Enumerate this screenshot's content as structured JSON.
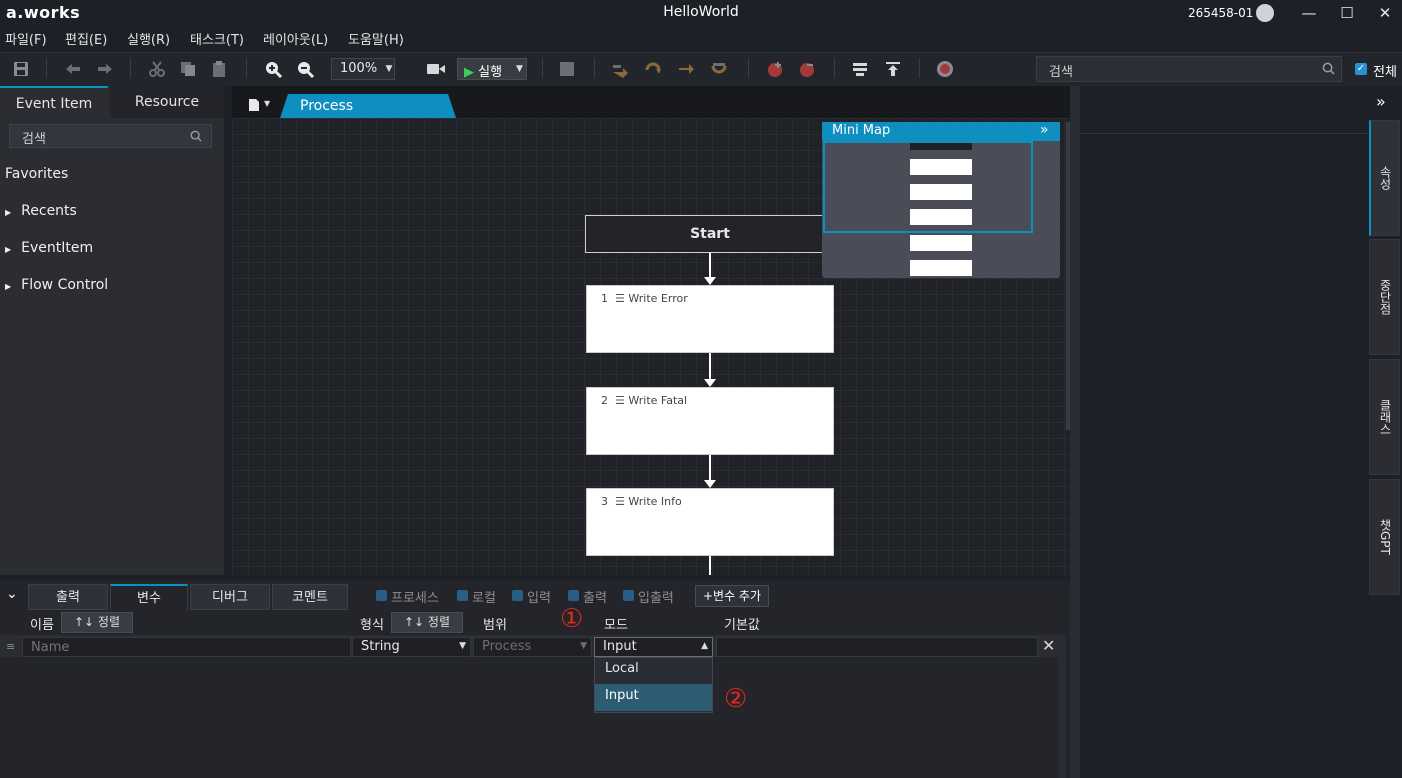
{
  "app": {
    "logo": "a.works",
    "title": "HelloWorld",
    "user_id": "265458-01"
  },
  "menu": [
    "파일(F)",
    "편집(E)",
    "실행(R)",
    "태스크(T)",
    "레이아웃(L)",
    "도움말(H)"
  ],
  "toolbar": {
    "zoom": "100%",
    "run_label": "실행",
    "search_placeholder": "검색",
    "all_label": "전체"
  },
  "left_panel": {
    "tabs": [
      "Event Item",
      "Resource"
    ],
    "search_placeholder": "검색",
    "favorites": "Favorites",
    "tree": [
      "Recents",
      "EventItem",
      "Flow Control"
    ]
  },
  "canvas": {
    "tab": "Process",
    "start": "Start",
    "nodes": [
      {
        "num": "1",
        "label": "Write Error"
      },
      {
        "num": "2",
        "label": "Write Fatal"
      },
      {
        "num": "3",
        "label": "Write Info"
      }
    ],
    "minimap_title": "Mini Map"
  },
  "right_tabs": [
    "속성",
    "중단점",
    "클래스",
    "챗GPT"
  ],
  "bottom": {
    "tabs": [
      "출력",
      "변수",
      "디버그",
      "코멘트"
    ],
    "filters": [
      "프로세스",
      "로컬",
      "입력",
      "출력",
      "입출력"
    ],
    "add_var": "+변수 추가",
    "columns": {
      "name": "이름",
      "type": "형식",
      "scope": "범위",
      "mode": "모드",
      "default": "기본값"
    },
    "sort": "↑↓ 정렬",
    "row": {
      "name_placeholder": "Name",
      "type": "String",
      "scope": "Process",
      "mode": "Input"
    },
    "mode_options": [
      "Local",
      "Input"
    ]
  },
  "annotations": [
    "①",
    "②"
  ],
  "colors": {
    "accent": "#0f8ec0",
    "selection": "#2c5d73",
    "annotation": "#e0281e"
  }
}
